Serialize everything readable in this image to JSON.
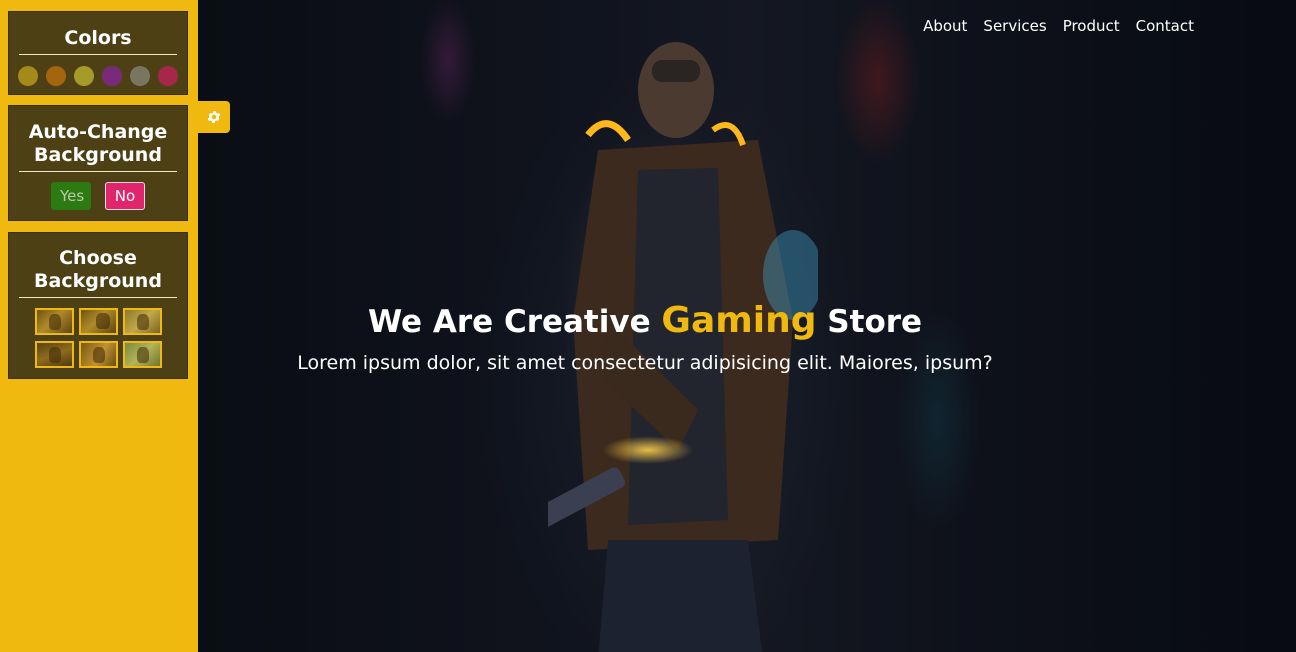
{
  "colors": {
    "accent": "#f0b90f",
    "panel": "#4d4015",
    "yes": "#2c7a12",
    "no": "#e0256c"
  },
  "settings": {
    "colors_panel": {
      "title": "Colors",
      "swatches": [
        "#a58a1a",
        "#a5650f",
        "#a59a2a",
        "#7a2a7a",
        "#7a7560",
        "#a5284a"
      ]
    },
    "auto_change": {
      "title": "Auto-Change Background",
      "yes_label": "Yes",
      "no_label": "No"
    },
    "choose_background": {
      "title": "Choose Background",
      "thumbnail_count": 6
    },
    "toggle_icon": "gear-icon"
  },
  "nav": {
    "items": [
      "About",
      "Services",
      "Product",
      "Contact"
    ]
  },
  "hero": {
    "headline_before": "We Are Creative",
    "headline_accent": "Gaming",
    "headline_after": "Store",
    "subtitle": "Lorem ipsum dolor, sit amet consectetur adipisicing elit. Maiores, ipsum?"
  }
}
